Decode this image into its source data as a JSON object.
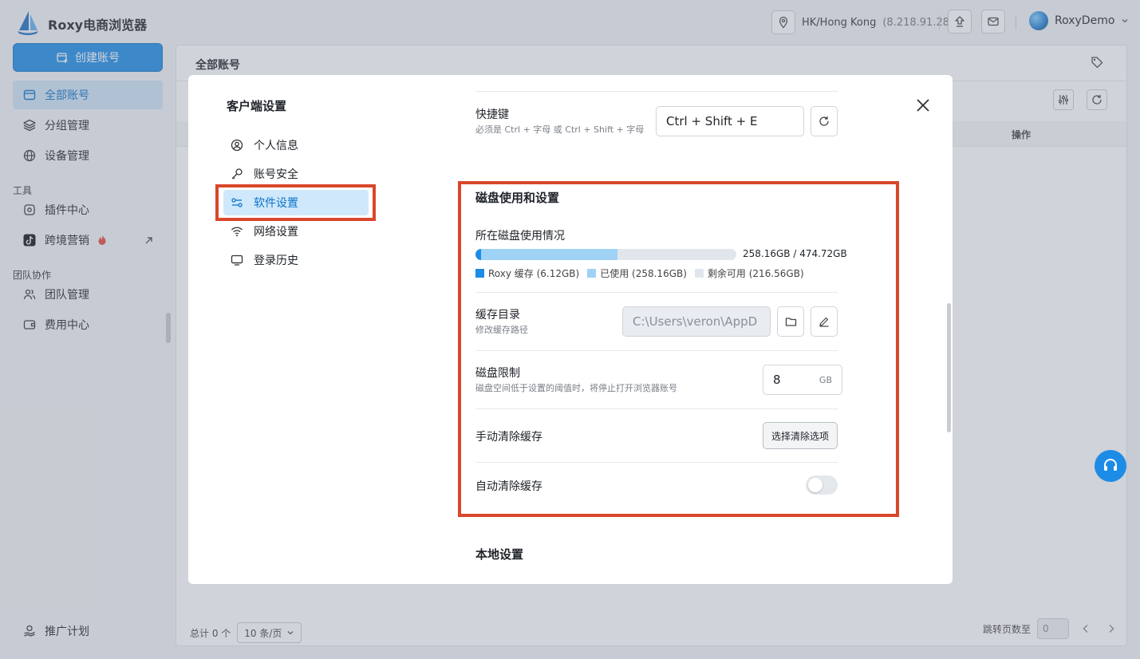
{
  "app": {
    "title": "Roxy电商浏览器"
  },
  "topbar": {
    "location": "HK/Hong Kong",
    "ip": "(8.218.91.28)",
    "username": "RoxyDemo"
  },
  "sidebar": {
    "create_label": "创建账号",
    "items": [
      {
        "label": "全部账号"
      },
      {
        "label": "分组管理"
      },
      {
        "label": "设备管理"
      },
      {
        "label": "插件中心"
      },
      {
        "label": "跨境营销"
      },
      {
        "label": "团队管理"
      },
      {
        "label": "费用中心"
      },
      {
        "label": "推广计划"
      }
    ],
    "sections": {
      "tools": "工具",
      "team": "团队协作"
    }
  },
  "main": {
    "title": "全部账号",
    "col_op": "操作"
  },
  "footer": {
    "total": "总计 0 个",
    "page_size": "10 条/页",
    "jump_label": "跳转页数至",
    "jump_value": "0"
  },
  "modal": {
    "title": "客户端设置",
    "nav": [
      {
        "label": "个人信息"
      },
      {
        "label": "账号安全"
      },
      {
        "label": "软件设置"
      },
      {
        "label": "网络设置"
      },
      {
        "label": "登录历史"
      }
    ],
    "shortcut": {
      "label": "快捷键",
      "hint": "必须是 Ctrl + 字母 或 Ctrl + Shift + 字母",
      "value": "Ctrl + Shift + E"
    },
    "disk": {
      "section_title": "磁盘使用和设置",
      "usage_label": "所在磁盘使用情况",
      "usage_text": "258.16GB / 474.72GB",
      "roxy_fraction": 0.0129,
      "used_fraction": 0.5438,
      "legend": {
        "roxy": "Roxy 缓存 (6.12GB)",
        "used": "已使用 (258.16GB)",
        "free": "剩余可用 (216.56GB)"
      },
      "colors": {
        "roxy": "#1d8ce6",
        "used": "#9fd2f5",
        "free": "#e1e6ec"
      },
      "cache_dir": {
        "label": "缓存目录",
        "hint": "修改缓存路径",
        "value": "C:\\Users\\veron\\AppD"
      },
      "limit": {
        "label": "磁盘限制",
        "hint": "磁盘空间低于设置的阈值时，将停止打开浏览器账号",
        "value": "8",
        "unit": "GB"
      },
      "manual_clear": {
        "label": "手动清除缓存",
        "button": "选择清除选项"
      },
      "auto_clear": {
        "label": "自动清除缓存",
        "enabled": false
      }
    },
    "local": {
      "section_title": "本地设置"
    }
  }
}
